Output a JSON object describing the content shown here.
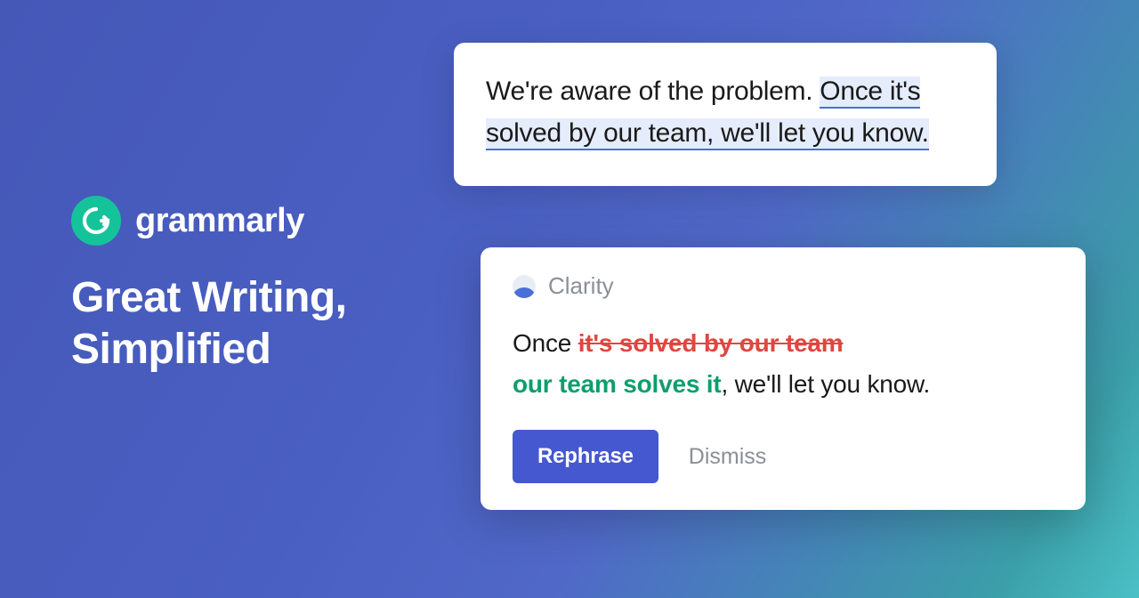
{
  "brand": {
    "name": "grammarly",
    "tagline_line1": "Great Writing,",
    "tagline_line2": "Simplified",
    "logo_letter": "G",
    "accent_color": "#15c39a"
  },
  "sample": {
    "plain": "We're aware of the problem. ",
    "highlighted": "Once it's solved by our team, we'll let you know."
  },
  "suggestion": {
    "category": "Clarity",
    "prefix": "Once ",
    "strike": "it's solved by our team",
    "replacement": "our team solves it",
    "suffix": ", we'll let you know."
  },
  "actions": {
    "primary": "Rephrase",
    "secondary": "Dismiss"
  }
}
